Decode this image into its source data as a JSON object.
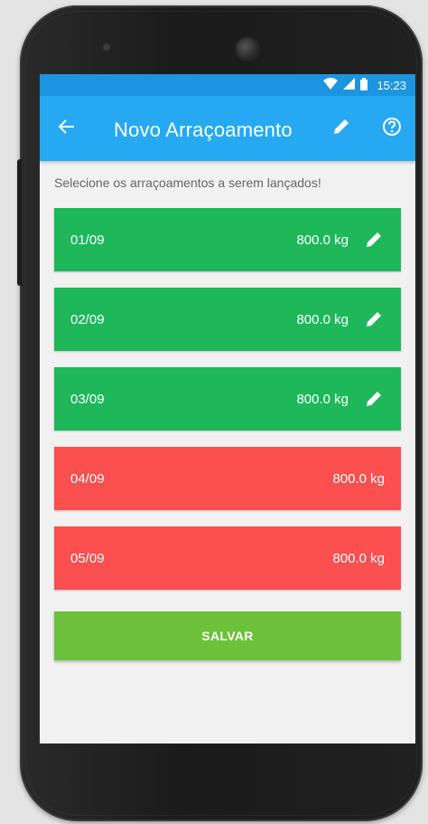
{
  "status_bar": {
    "time": "15:23",
    "icons": [
      "wifi-icon",
      "signal-icon",
      "battery-icon"
    ]
  },
  "app_bar": {
    "title": "Novo Arraçoamento",
    "icons": {
      "back": "arrow-left-icon",
      "edit": "pencil-icon",
      "help": "help-circle-icon"
    }
  },
  "main": {
    "instruction": "Selecione os arraçoamentos a serem lançados!",
    "items": [
      {
        "date": "01/09",
        "weight": "800.0 kg",
        "status": "ok",
        "editable": true
      },
      {
        "date": "02/09",
        "weight": "800.0 kg",
        "status": "ok",
        "editable": true
      },
      {
        "date": "03/09",
        "weight": "800.0 kg",
        "status": "ok",
        "editable": true
      },
      {
        "date": "04/09",
        "weight": "800.0 kg",
        "status": "pending",
        "editable": false
      },
      {
        "date": "05/09",
        "weight": "800.0 kg",
        "status": "pending",
        "editable": false
      }
    ],
    "save_label": "SALVAR"
  },
  "colors": {
    "status_bar": "#1c95e0",
    "app_bar": "#26a9f0",
    "item_ok": "#1eb75a",
    "item_pending": "#fb5050",
    "save_button": "#6cc13a",
    "background": "#f1f1f1"
  }
}
